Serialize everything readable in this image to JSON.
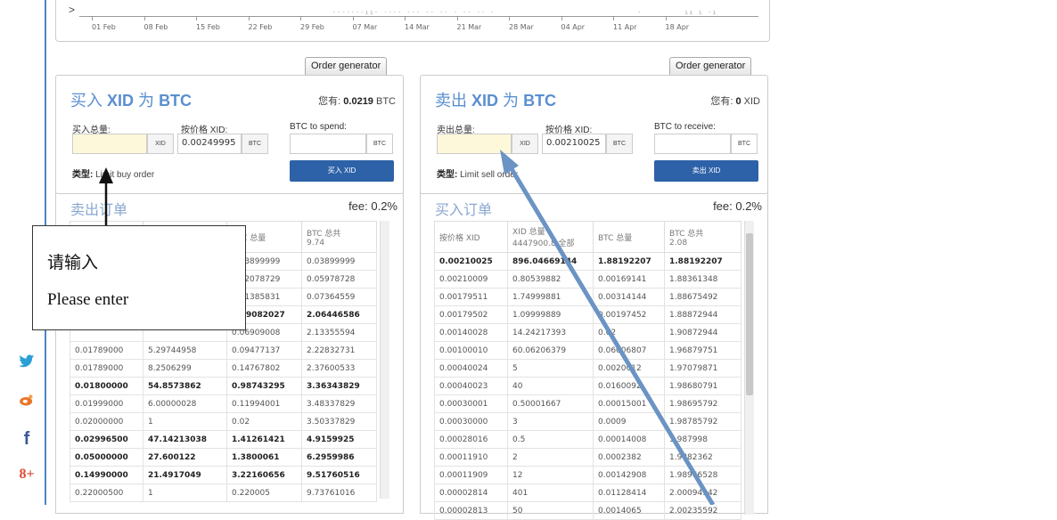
{
  "chart": {
    "ticks": [
      "01 Feb",
      "08 Feb",
      "15 Feb",
      "22 Feb",
      "29 Feb",
      "07 Mar",
      "14 Mar",
      "21 Mar",
      "28 Mar",
      "04 Apr",
      "11 Apr",
      "18 Apr"
    ],
    "arrow": ">"
  },
  "social": [
    {
      "icon": "twitter-icon",
      "glyph": "🐦",
      "color": "#2a9fd6"
    },
    {
      "icon": "weibo-icon",
      "glyph": "◉",
      "color": "#e8742a"
    },
    {
      "icon": "facebook-icon",
      "glyph": "f",
      "color": "#3b5998"
    },
    {
      "icon": "google-plus-icon",
      "glyph": "8+",
      "color": "#dc4a38"
    }
  ],
  "buy": {
    "order_generator": "Order generator",
    "title_prefix": "买入",
    "title_coin": "XID",
    "title_mid": "为",
    "title_base": "BTC",
    "balance_label": "您有:",
    "balance_value": "0.0219",
    "balance_unit": "BTC",
    "amount_label": "买入总量:",
    "price_label": "按价格 XID:",
    "total_label": "BTC to spend:",
    "amount_value": "",
    "amount_unit": "XID",
    "price_value": "0.00249995",
    "price_unit": "BTC",
    "total_value": "",
    "total_unit": "BTC",
    "type_label": "类型:",
    "type_value": "Limit buy order",
    "button": "买入 XID"
  },
  "sell": {
    "order_generator": "Order generator",
    "title_prefix": "卖出",
    "title_coin": "XID",
    "title_mid": "为",
    "title_base": "BTC",
    "balance_label": "您有:",
    "balance_value": "0",
    "balance_unit": "XID",
    "amount_label": "卖出总量:",
    "price_label": "按价格 XID:",
    "total_label": "BTC to receive:",
    "amount_value": "",
    "amount_unit": "XID",
    "price_value": "0.00210025",
    "price_unit": "BTC",
    "total_value": "",
    "total_unit": "BTC",
    "type_label": "类型:",
    "type_value": "Limit sell order",
    "button": "卖出 XID"
  },
  "sell_orders": {
    "title": "卖出订单",
    "fee": "fee: 0.2%",
    "headers": [
      "",
      "",
      "BTC 总量",
      "BTC 总共\n9.74"
    ],
    "rows": [
      [
        "",
        "",
        "0.03899999",
        "0.03899999",
        false
      ],
      [
        "",
        "",
        "0.02078729",
        "0.05978728",
        false
      ],
      [
        "",
        "",
        "0.01385831",
        "0.07364559",
        false
      ],
      [
        "",
        "",
        "1.99082027",
        "2.06446586",
        true
      ],
      [
        "",
        "",
        "0.06909008",
        "2.13355594",
        false
      ],
      [
        "0.01789000",
        "5.29744958",
        "0.09477137",
        "2.22832731",
        false
      ],
      [
        "0.01789000",
        "8.2506299",
        "0.14767802",
        "2.37600533",
        false
      ],
      [
        "0.01800000",
        "54.8573862",
        "0.98743295",
        "3.36343829",
        true
      ],
      [
        "0.01999000",
        "6.00000028",
        "0.11994001",
        "3.48337829",
        false
      ],
      [
        "0.02000000",
        "1",
        "0.02",
        "3.50337829",
        false
      ],
      [
        "0.02996500",
        "47.14213038",
        "1.41261421",
        "4.9159925",
        true
      ],
      [
        "0.05000000",
        "27.600122",
        "1.3800061",
        "6.2959986",
        true
      ],
      [
        "0.14990000",
        "21.4917049",
        "3.22160656",
        "9.51760516",
        true
      ],
      [
        "0.22000500",
        "1",
        "0.220005",
        "9.73761016",
        false
      ]
    ]
  },
  "buy_orders": {
    "title": "买入订单",
    "fee": "fee: 0.2%",
    "headers": [
      "按价格 XID",
      "XID 总量\n4447900.8 全部",
      "BTC 总量",
      "BTC 总共\n2.08"
    ],
    "rows": [
      [
        "0.00210025",
        "896.04669144",
        "1.88192207",
        "1.88192207",
        true
      ],
      [
        "0.00210009",
        "0.80539882",
        "0.00169141",
        "1.88361348",
        false
      ],
      [
        "0.00179511",
        "1.74999881",
        "0.00314144",
        "1.88675492",
        false
      ],
      [
        "0.00179502",
        "1.09999889",
        "0.00197452",
        "1.88872944",
        false
      ],
      [
        "0.00140028",
        "14.24217393",
        "0.02",
        "1.90872944",
        false
      ],
      [
        "0.00100010",
        "60.06206379",
        "0.06006807",
        "1.96879751",
        false
      ],
      [
        "0.00040024",
        "5",
        "0.0020012",
        "1.97079871",
        false
      ],
      [
        "0.00040023",
        "40",
        "0.0160092",
        "1.98680791",
        false
      ],
      [
        "0.00030001",
        "0.50001667",
        "0.00015001",
        "1.98695792",
        false
      ],
      [
        "0.00030000",
        "3",
        "0.0009",
        "1.98785792",
        false
      ],
      [
        "0.00028016",
        "0.5",
        "0.00014008",
        "1.987998",
        false
      ],
      [
        "0.00011910",
        "2",
        "0.0002382",
        "1.9882362",
        false
      ],
      [
        "0.00011909",
        "12",
        "0.00142908",
        "1.98966528",
        false
      ],
      [
        "0.00002814",
        "401",
        "0.01128414",
        "2.00094942",
        false
      ],
      [
        "0.00002813",
        "50",
        "0.0014065",
        "2.00235592",
        false
      ]
    ]
  },
  "callout": {
    "line1": "请输入",
    "line2": "Please enter"
  },
  "colors": {
    "accent": "#2e62a8",
    "title_blue": "#5a8fd0",
    "arrow_blue": "#6b93c4"
  }
}
